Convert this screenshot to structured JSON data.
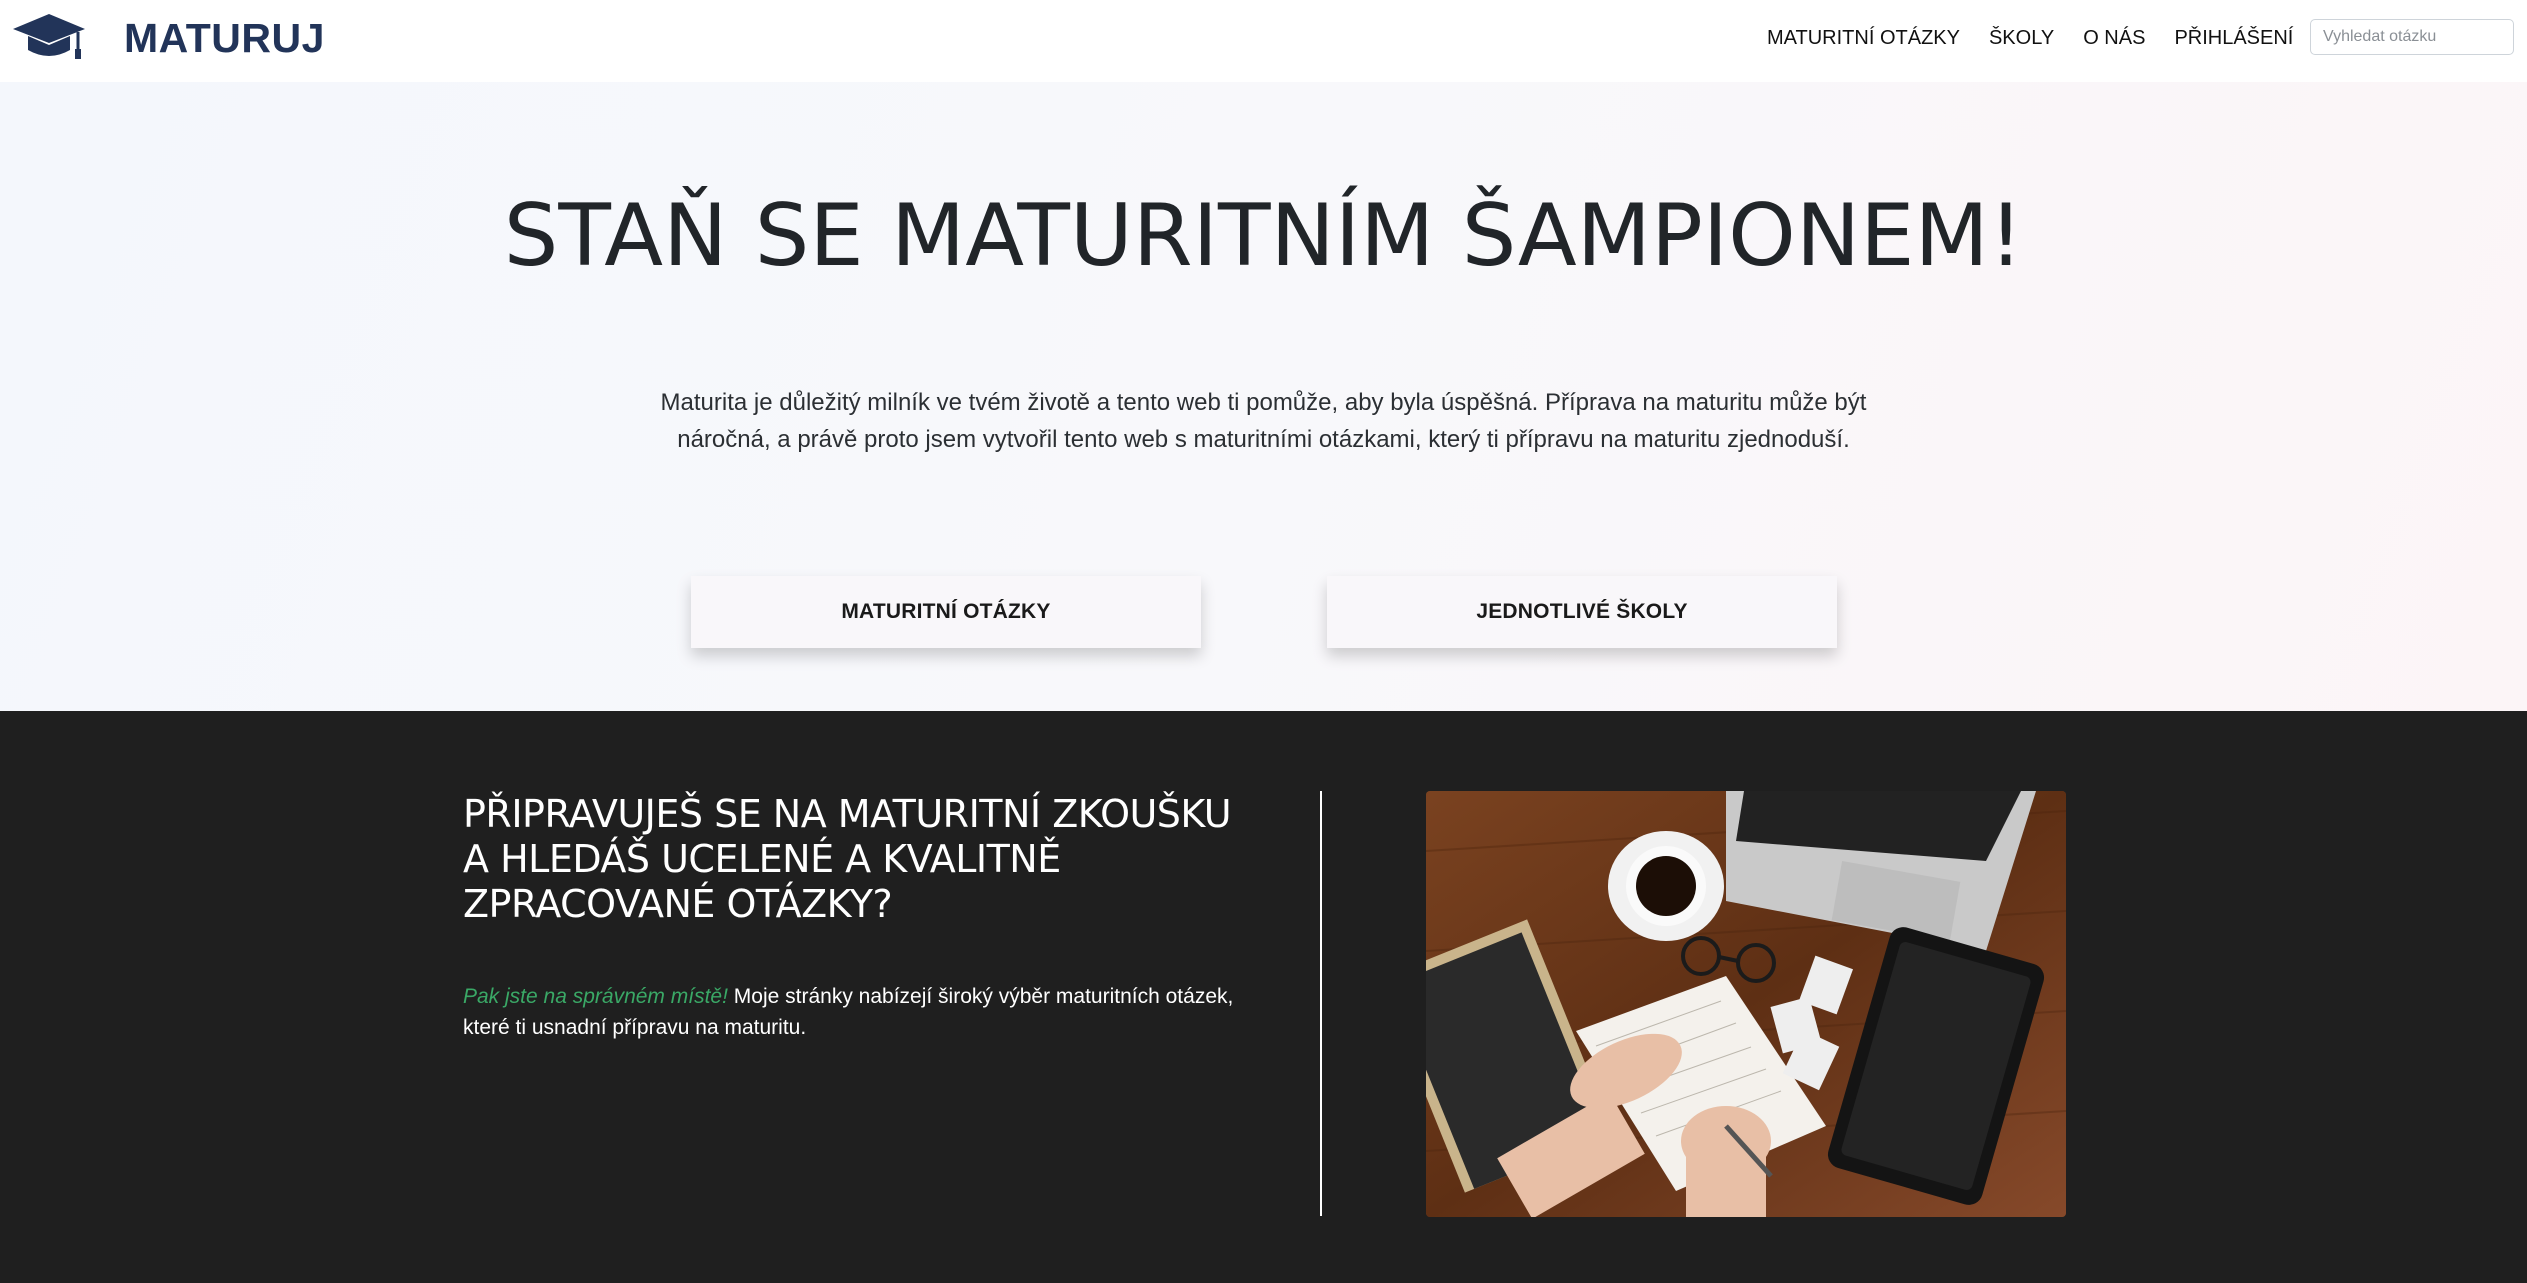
{
  "brand": {
    "name": "MATURUJ",
    "icon": "graduation-cap-icon",
    "color": "#223459"
  },
  "nav": {
    "links": [
      "MATURITNÍ OTÁZKY",
      "ŠKOLY",
      "O NÁS",
      "PŘIHLÁŠENÍ"
    ],
    "search_placeholder": "Vyhledat otázku"
  },
  "hero": {
    "title": "STAŇ SE MATURITNÍM ŠAMPIONEM!",
    "lead": "Maturita je důležitý milník ve tvém životě a tento web ti pomůže, aby byla úspěšná. Příprava na maturitu může být náročná, a právě proto jsem vytvořil tento web s maturitními otázkami, který ti přípravu na maturitu zjednoduší.",
    "buttons": [
      "MATURITNÍ OTÁZKY",
      "JEDNOTLIVÉ ŠKOLY"
    ]
  },
  "feature": {
    "heading": "PŘIPRAVUJEŠ SE NA MATURITNÍ ZKOUŠKU A HLEDÁŠ UCELENÉ A KVALITNĚ ZPRACOVANÉ OTÁZKY?",
    "accent_text": "Pak jste na správném místě!",
    "body_text": "Moje stránky nabízejí široký výběr maturitních otázek, které ti usnadní přípravu na maturitu.",
    "accent_color": "#3aa866",
    "image": "desk-study-photo"
  }
}
